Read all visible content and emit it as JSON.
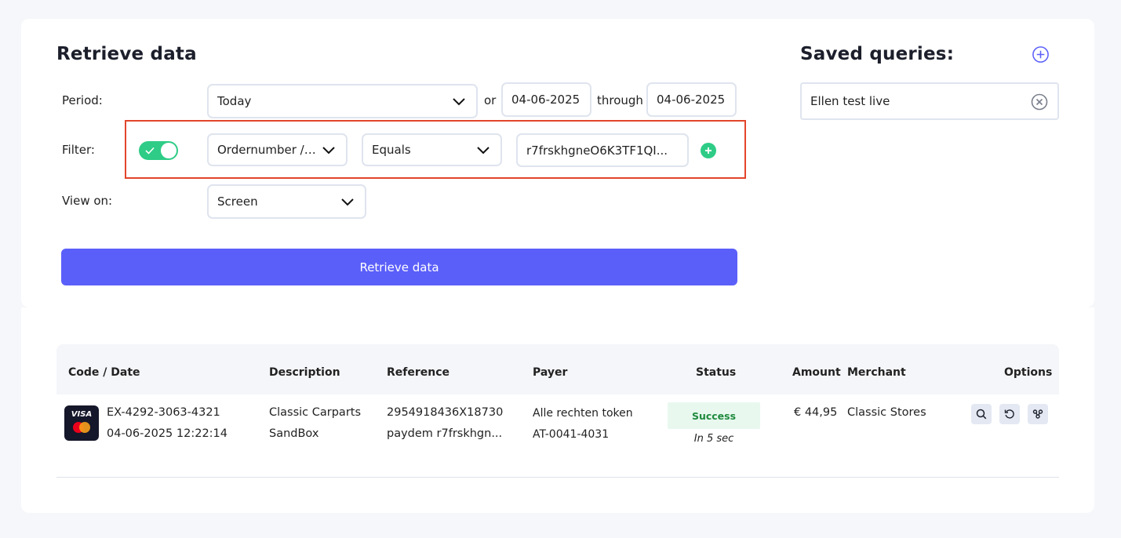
{
  "form": {
    "title": "Retrieve data",
    "period": {
      "label": "Period:",
      "preset": "Today",
      "or_label": "or",
      "from": "04-06-2025",
      "through_label": "through",
      "to": "04-06-2025"
    },
    "filter": {
      "label": "Filter:",
      "enabled": true,
      "field": "Ordernumber / Reference",
      "operator": "Equals",
      "value": "r7frskhgneO6K3TF1QI..."
    },
    "view_on": {
      "label": "View on:",
      "value": "Screen"
    },
    "submit_label": "Retrieve data"
  },
  "saved_queries": {
    "title": "Saved queries:",
    "items": [
      "Ellen test live"
    ]
  },
  "table": {
    "columns": [
      "Code / Date",
      "Description",
      "Reference",
      "Payer",
      "Status",
      "Amount",
      "Merchant",
      "Options"
    ],
    "rows": [
      {
        "card_brand": "VISA",
        "code": "EX-4292-3063-4321",
        "date": "04-06-2025 12:22:14",
        "description_1": "Classic Carparts",
        "description_2": "SandBox",
        "reference_1": "2954918436X18730",
        "reference_2": "paydem r7frskhgn...",
        "payer_1": "Alle rechten token",
        "payer_2": "AT-0041-4031",
        "status": "Success",
        "status_sub": "In 5 sec",
        "amount": "€ 44,95",
        "merchant": "Classic Stores",
        "options": [
          "search-icon",
          "refund-icon",
          "link-icon"
        ]
      }
    ]
  },
  "colors": {
    "accent": "#5b5ff9",
    "success": "#2ecc86",
    "highlight": "#e2452b"
  }
}
